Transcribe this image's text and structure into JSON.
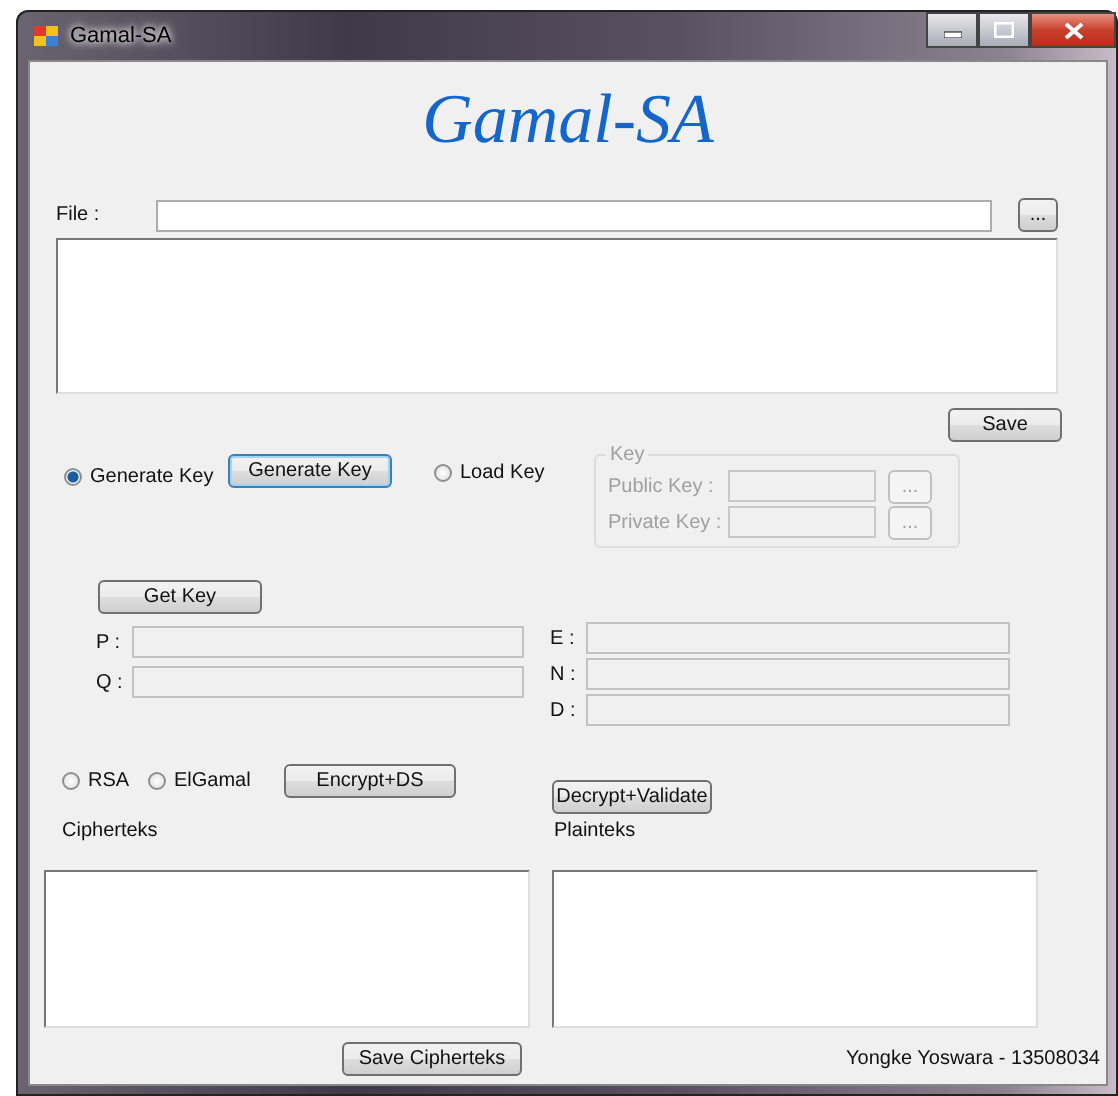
{
  "window": {
    "title": "Gamal-SA"
  },
  "heading": "Gamal-SA",
  "file": {
    "label": "File :",
    "browse_button": "..."
  },
  "save_button": "Save",
  "key_source": [
    {
      "label": "Generate Key",
      "selected": true
    },
    {
      "label": "Load Key",
      "selected": false
    }
  ],
  "generate_button": "Generate Key",
  "key_group": {
    "title": "Key",
    "disabled": true,
    "fields": [
      {
        "label": "Public Key :",
        "button": "..."
      },
      {
        "label": "Private Key :",
        "button": "..."
      }
    ]
  },
  "get_key_button": "Get Key",
  "params_left": [
    {
      "label": "P :",
      "disabled": true
    },
    {
      "label": "Q :",
      "disabled": true
    }
  ],
  "params_right": [
    {
      "label": "E :",
      "disabled": true
    },
    {
      "label": "N :",
      "disabled": true
    },
    {
      "label": "D :",
      "disabled": true
    }
  ],
  "algorithm": [
    {
      "label": "RSA",
      "selected": false
    },
    {
      "label": "ElGamal",
      "selected": false
    }
  ],
  "encrypt_button": "Encrypt+DS",
  "decrypt_button": "Decrypt+Validate",
  "cipher_label": "Cipherteks",
  "plain_label": "Plainteks",
  "save_cipher_button": "Save Cipherteks",
  "footer": "Yongke Yoswara - 13508034"
}
